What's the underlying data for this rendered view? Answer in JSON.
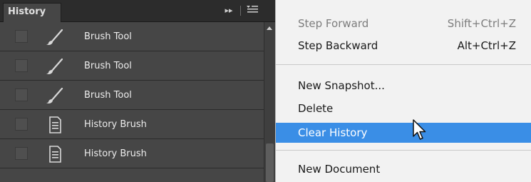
{
  "panel": {
    "tab_label": "History",
    "header_icons": [
      "double-arrow-icon",
      "panel-menu-icon"
    ],
    "rows": [
      {
        "label": "Brush Tool",
        "icon": "brush-icon"
      },
      {
        "label": "Brush Tool",
        "icon": "brush-icon"
      },
      {
        "label": "Brush Tool",
        "icon": "brush-icon"
      },
      {
        "label": "History Brush",
        "icon": "document-icon"
      },
      {
        "label": "History Brush",
        "icon": "document-icon"
      }
    ]
  },
  "menu": {
    "items": [
      {
        "label": "Step Forward",
        "shortcut": "Shift+Ctrl+Z",
        "state": "disabled"
      },
      {
        "label": "Step Backward",
        "shortcut": "Alt+Ctrl+Z",
        "state": "enabled"
      },
      {
        "label": "New Snapshot...",
        "shortcut": "",
        "state": "enabled"
      },
      {
        "label": "Delete",
        "shortcut": "",
        "state": "enabled"
      },
      {
        "label": "Clear History",
        "shortcut": "",
        "state": "highlighted"
      },
      {
        "label": "New Document",
        "shortcut": "",
        "state": "enabled"
      }
    ]
  },
  "colors": {
    "panel_bg": "#464646",
    "menu_bg": "#f2f2f2",
    "highlight": "#3a8ee6"
  }
}
